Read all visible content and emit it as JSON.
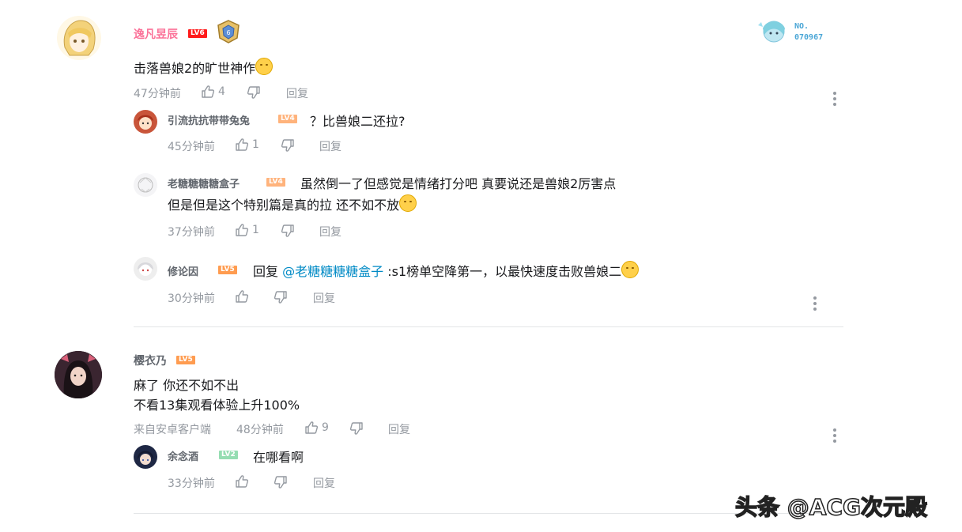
{
  "comments": [
    {
      "user": "逸凡昱辰",
      "level": "LV6",
      "fan_badge_no": "NO.",
      "fan_badge_num": "070967",
      "text": "击落兽娘2的旷世神作",
      "time": "47分钟前",
      "likes": "4",
      "reply_label": "回复",
      "replies": [
        {
          "user": "引流抗抗带带兔兔",
          "level": "LV4",
          "text": "？比兽娘二还拉?",
          "time": "45分钟前",
          "likes": "1",
          "reply_label": "回复"
        },
        {
          "user": "老糖糖糖糖盒子",
          "level": "LV4",
          "text_line1": "虽然倒一了但感觉是情绪打分吧 真要说还是兽娘2厉害点",
          "text_line2": "但是但是这个特别篇是真的拉 还不如不放",
          "time": "37分钟前",
          "likes": "1",
          "reply_label": "回复"
        },
        {
          "user": "修论因",
          "level": "LV5",
          "reply_prefix": "回复",
          "mention": "@老糖糖糖糖盒子",
          "text": ":s1榜单空降第一，以最快速度击败兽娘二",
          "time": "30分钟前",
          "reply_label": "回复"
        }
      ]
    },
    {
      "user": "樱衣乃",
      "level": "LV5",
      "text_line1": "麻了 你还不如不出",
      "text_line2": "不看13集观看体验上升100%",
      "source": "来自安卓客户端",
      "time": "48分钟前",
      "likes": "9",
      "reply_label": "回复",
      "replies": [
        {
          "user": "余念酒",
          "level": "LV2",
          "text": "在哪看啊",
          "time": "33分钟前",
          "reply_label": "回复"
        }
      ]
    }
  ],
  "watermark": "头条 @ACG次元殿",
  "colors": {
    "username_vip": "#fb7299",
    "username": "#61666d",
    "lv6": "#ff1b1b",
    "lv5": "#ff9c50",
    "lv4": "#ffb37c",
    "lv2": "#95ddb2",
    "link": "#008ac5"
  }
}
